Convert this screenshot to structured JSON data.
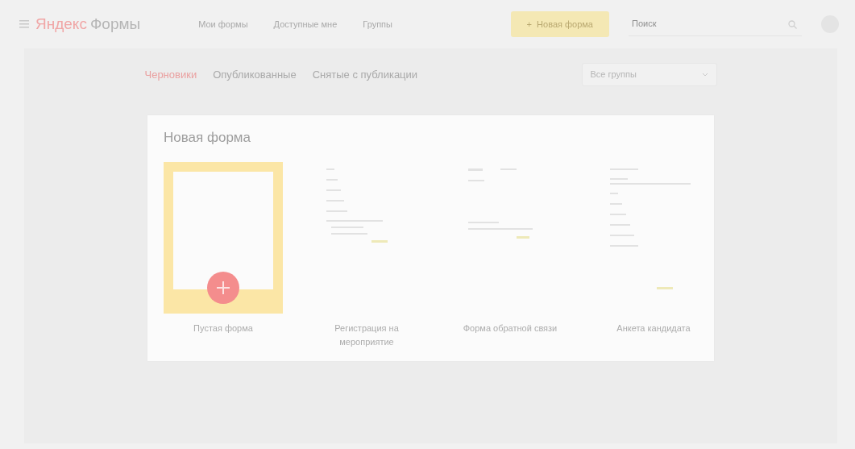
{
  "header": {
    "logo": {
      "brand": "Яндекс",
      "product": "Формы"
    },
    "nav": [
      {
        "label": "Мои формы",
        "selected": false
      },
      {
        "label": "Доступные мне",
        "selected": false
      },
      {
        "label": "Группы",
        "selected": false
      }
    ],
    "new_button": {
      "icon": "+",
      "label": "Новая форма"
    },
    "search": {
      "placeholder": "Поиск"
    }
  },
  "tabs": [
    {
      "label": "Черновики",
      "selected": true
    },
    {
      "label": "Опубликованные",
      "selected": false
    },
    {
      "label": "Снятые с публикации",
      "selected": false
    }
  ],
  "group_select": {
    "value": "Все группы"
  },
  "dialog": {
    "title": "Новая форма",
    "templates": [
      {
        "kind": "blank",
        "label": "Пустая форма"
      },
      {
        "kind": "template",
        "label": "Регистрация на мероприятие"
      },
      {
        "kind": "template",
        "label": "Форма обратной связи"
      },
      {
        "kind": "template",
        "label": "Анкета кандидата"
      }
    ]
  }
}
